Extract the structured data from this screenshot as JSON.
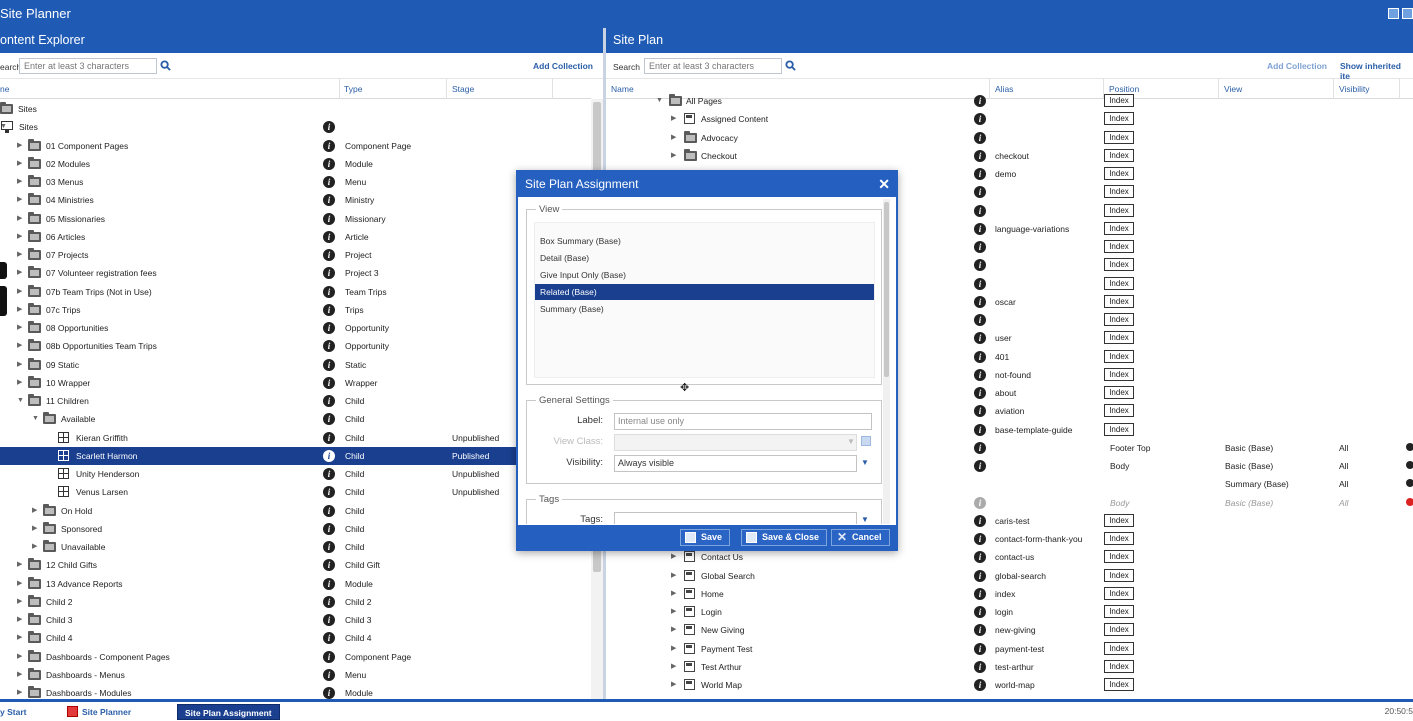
{
  "app": {
    "title": "Site Planner"
  },
  "content_explorer": {
    "title": "ontent Explorer",
    "search_label": "earch",
    "search_placeholder": "Enter at least 3 characters",
    "add_collection": "Add Collection",
    "columns": {
      "name": "ne",
      "type": "Type",
      "stage": "Stage"
    },
    "rows": [
      {
        "label": "Sites",
        "type": "",
        "stage": "",
        "indent": 0,
        "icon": "folder",
        "tw": "",
        "info": false
      },
      {
        "label": "Sites",
        "type": "",
        "stage": "",
        "indent": 0,
        "icon": "monitor",
        "tw": "▼",
        "info": true
      },
      {
        "label": "01 Component Pages",
        "type": "Component Page",
        "stage": "",
        "indent": 1,
        "icon": "folder",
        "tw": "▶",
        "info": true
      },
      {
        "label": "02 Modules",
        "type": "Module",
        "stage": "",
        "indent": 1,
        "icon": "folder",
        "tw": "▶",
        "info": true
      },
      {
        "label": "03 Menus",
        "type": "Menu",
        "stage": "",
        "indent": 1,
        "icon": "folder",
        "tw": "▶",
        "info": true
      },
      {
        "label": "04 Ministries",
        "type": "Ministry",
        "stage": "",
        "indent": 1,
        "icon": "folder",
        "tw": "▶",
        "info": true
      },
      {
        "label": "05 Missionaries",
        "type": "Missionary",
        "stage": "",
        "indent": 1,
        "icon": "folder",
        "tw": "▶",
        "info": true
      },
      {
        "label": "06 Articles",
        "type": "Article",
        "stage": "",
        "indent": 1,
        "icon": "folder",
        "tw": "▶",
        "info": true
      },
      {
        "label": "07 Projects",
        "type": "Project",
        "stage": "",
        "indent": 1,
        "icon": "folder",
        "tw": "▶",
        "info": true
      },
      {
        "label": "07 Volunteer registration fees",
        "type": "Project 3",
        "stage": "",
        "indent": 1,
        "icon": "folder",
        "tw": "▶",
        "info": true
      },
      {
        "label": "07b Team Trips (Not in Use)",
        "type": "Team Trips",
        "stage": "",
        "indent": 1,
        "icon": "folder",
        "tw": "▶",
        "info": true
      },
      {
        "label": "07c Trips",
        "type": "Trips",
        "stage": "",
        "indent": 1,
        "icon": "folder",
        "tw": "▶",
        "info": true
      },
      {
        "label": "08 Opportunities",
        "type": "Opportunity",
        "stage": "",
        "indent": 1,
        "icon": "folder",
        "tw": "▶",
        "info": true
      },
      {
        "label": "08b Opportunities Team Trips",
        "type": "Opportunity",
        "stage": "",
        "indent": 1,
        "icon": "folder",
        "tw": "▶",
        "info": true
      },
      {
        "label": "09 Static",
        "type": "Static",
        "stage": "",
        "indent": 1,
        "icon": "folder",
        "tw": "▶",
        "info": true
      },
      {
        "label": "10 Wrapper",
        "type": "Wrapper",
        "stage": "",
        "indent": 1,
        "icon": "folder",
        "tw": "▶",
        "info": true
      },
      {
        "label": "11 Children",
        "type": "Child",
        "stage": "",
        "indent": 1,
        "icon": "folder",
        "tw": "▼",
        "info": true
      },
      {
        "label": "Available",
        "type": "Child",
        "stage": "",
        "indent": 2,
        "icon": "folder",
        "tw": "▼",
        "info": true
      },
      {
        "label": "Kieran Griffith",
        "type": "Child",
        "stage": "Unpublished",
        "indent": 3,
        "icon": "grid",
        "tw": "",
        "info": true
      },
      {
        "label": "Scarlett Harmon",
        "type": "Child",
        "stage": "Published",
        "indent": 3,
        "icon": "grid",
        "tw": "",
        "info": true,
        "selected": true
      },
      {
        "label": "Unity Henderson",
        "type": "Child",
        "stage": "Unpublished",
        "indent": 3,
        "icon": "grid",
        "tw": "",
        "info": true
      },
      {
        "label": "Venus Larsen",
        "type": "Child",
        "stage": "Unpublished",
        "indent": 3,
        "icon": "grid",
        "tw": "",
        "info": true
      },
      {
        "label": "On Hold",
        "type": "Child",
        "stage": "",
        "indent": 2,
        "icon": "folder",
        "tw": "▶",
        "info": true
      },
      {
        "label": "Sponsored",
        "type": "Child",
        "stage": "",
        "indent": 2,
        "icon": "folder",
        "tw": "▶",
        "info": true
      },
      {
        "label": "Unavailable",
        "type": "Child",
        "stage": "",
        "indent": 2,
        "icon": "folder",
        "tw": "▶",
        "info": true
      },
      {
        "label": "12 Child Gifts",
        "type": "Child Gift",
        "stage": "",
        "indent": 1,
        "icon": "folder",
        "tw": "▶",
        "info": true
      },
      {
        "label": "13 Advance Reports",
        "type": "Module",
        "stage": "",
        "indent": 1,
        "icon": "folder",
        "tw": "▶",
        "info": true
      },
      {
        "label": "Child 2",
        "type": "Child 2",
        "stage": "",
        "indent": 1,
        "icon": "folder",
        "tw": "▶",
        "info": true
      },
      {
        "label": "Child 3",
        "type": "Child 3",
        "stage": "",
        "indent": 1,
        "icon": "folder",
        "tw": "▶",
        "info": true
      },
      {
        "label": "Child 4",
        "type": "Child 4",
        "stage": "",
        "indent": 1,
        "icon": "folder",
        "tw": "▶",
        "info": true
      },
      {
        "label": "Dashboards - Component Pages",
        "type": "Component Page",
        "stage": "",
        "indent": 1,
        "icon": "folder",
        "tw": "▶",
        "info": true
      },
      {
        "label": "Dashboards - Menus",
        "type": "Menu",
        "stage": "",
        "indent": 1,
        "icon": "folder",
        "tw": "▶",
        "info": true
      },
      {
        "label": "Dashboards - Modules",
        "type": "Module",
        "stage": "",
        "indent": 1,
        "icon": "folder",
        "tw": "▶",
        "info": true
      }
    ]
  },
  "site_plan": {
    "title": "Site Plan",
    "search_label": "Search",
    "search_placeholder": "Enter at least 3 characters",
    "add_collection": "Add Collection",
    "show_inherited": "Show inherited ite",
    "columns": {
      "name": "Name",
      "alias": "Alias",
      "position": "Position",
      "view": "View",
      "visibility": "Visibility"
    },
    "rows": [
      {
        "label": "All Pages",
        "alias": "",
        "index": true,
        "icon": "folder",
        "tw": "▼",
        "indent": 0
      },
      {
        "label": "Assigned Content",
        "alias": "",
        "index": true,
        "icon": "page",
        "tw": "▶",
        "indent": 1
      },
      {
        "label": "Advocacy",
        "alias": "",
        "index": true,
        "icon": "folder",
        "tw": "▶",
        "indent": 1
      },
      {
        "label": "Checkout",
        "alias": "checkout",
        "index": true,
        "icon": "folder",
        "tw": "▶",
        "indent": 1
      },
      {
        "label": "",
        "alias": "demo",
        "index": true
      },
      {
        "label": "",
        "alias": "",
        "index": true
      },
      {
        "label": "",
        "alias": "",
        "index": true
      },
      {
        "label": "",
        "alias": "language-variations",
        "index": true
      },
      {
        "label": "",
        "alias": "",
        "index": true
      },
      {
        "label": "",
        "alias": "",
        "index": true
      },
      {
        "label": "",
        "alias": "",
        "index": true
      },
      {
        "label": "",
        "alias": "oscar",
        "index": true
      },
      {
        "label": "",
        "alias": "",
        "index": true
      },
      {
        "label": "",
        "alias": "user",
        "index": true
      },
      {
        "label": "",
        "alias": "401",
        "index": true
      },
      {
        "label": "",
        "alias": "not-found",
        "index": true
      },
      {
        "label": "",
        "alias": "about",
        "index": true
      },
      {
        "label": "",
        "alias": "aviation",
        "index": true
      },
      {
        "label": "",
        "alias": "base-template-guide",
        "index": true
      },
      {
        "label": "",
        "alias": "",
        "index": false,
        "position": "Footer Top",
        "view": "Basic (Base)",
        "visibility": "All",
        "eye": "dark"
      },
      {
        "label": "",
        "alias": "",
        "index": false,
        "position": "Body",
        "view": "Basic (Base)",
        "visibility": "All",
        "eye": "dark"
      },
      {
        "label": "",
        "alias": "",
        "index": false,
        "position": "",
        "view": "Summary (Base)",
        "visibility": "All",
        "eye": "dark",
        "noinfo": true
      },
      {
        "label": "",
        "alias": "",
        "index": false,
        "position": "Body",
        "view": "Basic (Base)",
        "visibility": "All",
        "eye": "red",
        "greyed": true
      },
      {
        "label": "",
        "alias": "caris-test",
        "index": true
      },
      {
        "label": "",
        "alias": "contact-form-thank-you",
        "index": true
      },
      {
        "label": "Contact Us",
        "alias": "contact-us",
        "index": true,
        "icon": "page",
        "tw": "▶",
        "indent": 1
      },
      {
        "label": "Global Search",
        "alias": "global-search",
        "index": true,
        "icon": "page",
        "tw": "▶",
        "indent": 1
      },
      {
        "label": "Home",
        "alias": "index",
        "index": true,
        "icon": "page",
        "tw": "▶",
        "indent": 1
      },
      {
        "label": "Login",
        "alias": "login",
        "index": true,
        "icon": "page",
        "tw": "▶",
        "indent": 1
      },
      {
        "label": "New Giving",
        "alias": "new-giving",
        "index": true,
        "icon": "page",
        "tw": "▶",
        "indent": 1
      },
      {
        "label": "Payment Test",
        "alias": "payment-test",
        "index": true,
        "icon": "page",
        "tw": "▶",
        "indent": 1
      },
      {
        "label": "Test Arthur",
        "alias": "test-arthur",
        "index": true,
        "icon": "page",
        "tw": "▶",
        "indent": 1
      },
      {
        "label": "World Map",
        "alias": "world-map",
        "index": true,
        "icon": "page",
        "tw": "▶",
        "indent": 1
      }
    ],
    "index_label": "Index"
  },
  "dialog": {
    "title": "Site Plan Assignment",
    "view_legend": "View",
    "views": [
      "Box Summary (Base)",
      "Detail (Base)",
      "Give Input Only (Base)",
      "Related (Base)",
      "Summary (Base)"
    ],
    "selected_view": 3,
    "general_legend": "General Settings",
    "label_label": "Label:",
    "label_placeholder": "Internal use only",
    "viewclass_label": "View Class:",
    "visibility_label": "Visibility:",
    "visibility_value": "Always visible",
    "tags_legend": "Tags",
    "tags_label": "Tags:",
    "save": "Save",
    "save_close": "Save & Close",
    "cancel": "Cancel"
  },
  "taskbar": {
    "start": "y Start",
    "site_planner": "Site Planner",
    "site_plan_assignment": "Site Plan Assignment",
    "clock": "20:50:5"
  }
}
